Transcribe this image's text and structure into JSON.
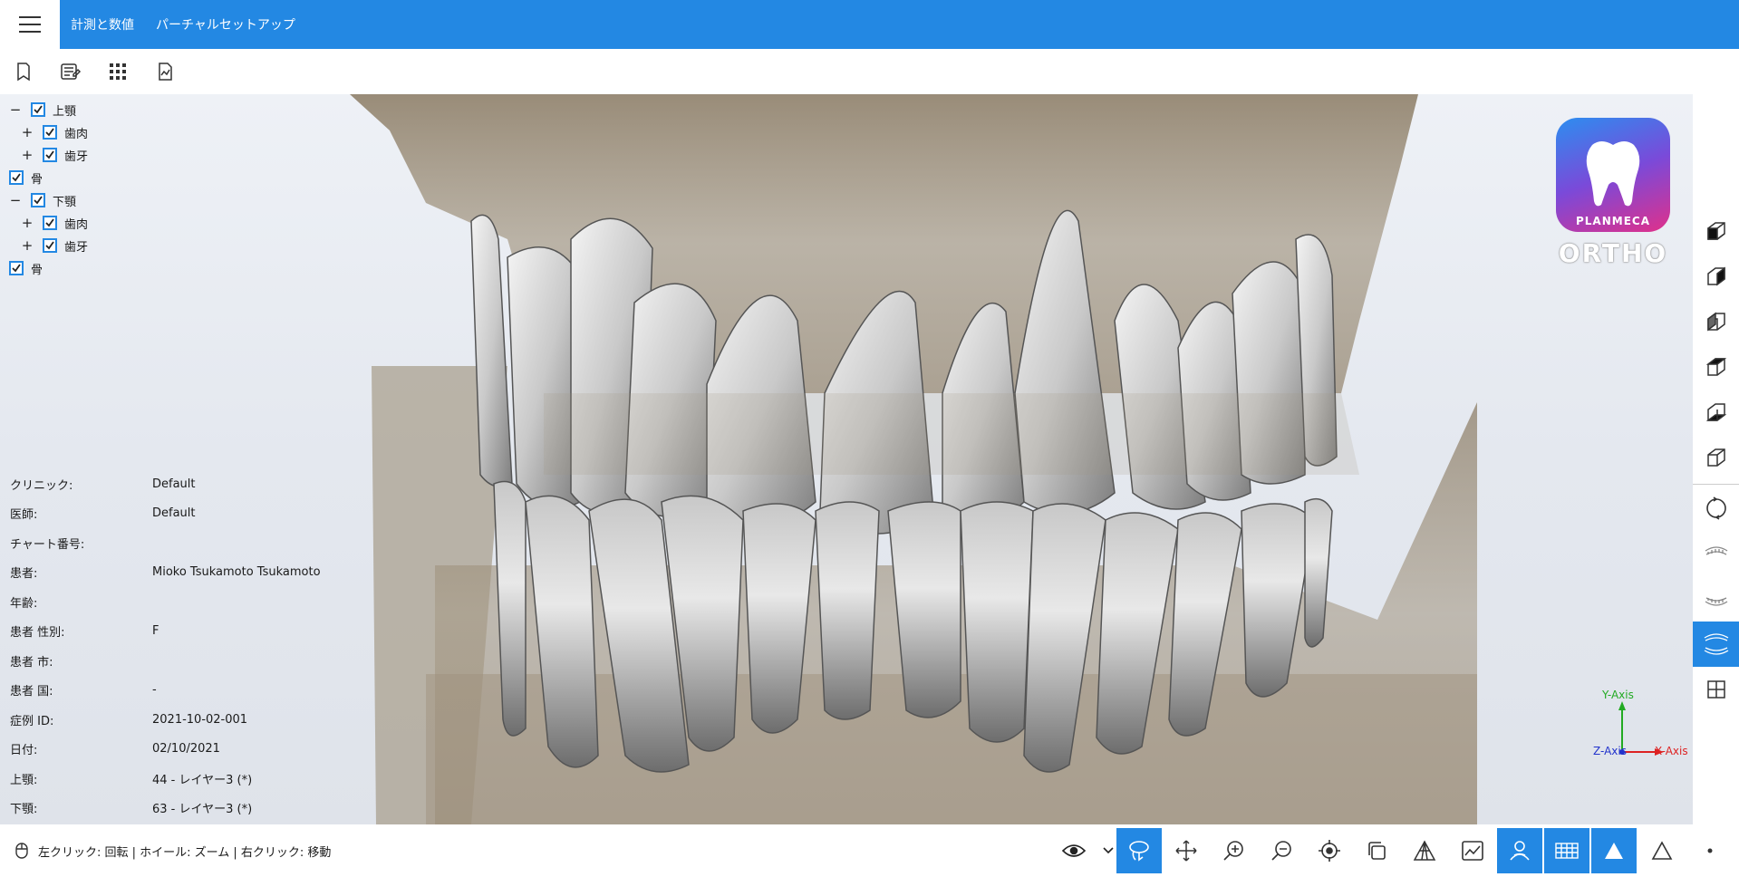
{
  "menu": {
    "items": [
      "計測と数値",
      "パーチャルセットアップ"
    ]
  },
  "tree": [
    {
      "expander": "−",
      "label": "上顎",
      "checked": true,
      "level": 0
    },
    {
      "expander": "+",
      "label": "歯肉",
      "checked": true,
      "level": 1
    },
    {
      "expander": "+",
      "label": "歯牙",
      "checked": true,
      "level": 1
    },
    {
      "expander": "",
      "label": "骨",
      "checked": true,
      "level": 2
    },
    {
      "expander": "−",
      "label": "下顎",
      "checked": true,
      "level": 0
    },
    {
      "expander": "+",
      "label": "歯肉",
      "checked": true,
      "level": 1
    },
    {
      "expander": "+",
      "label": "歯牙",
      "checked": true,
      "level": 1
    },
    {
      "expander": "",
      "label": "骨",
      "checked": true,
      "level": 2
    }
  ],
  "info": [
    {
      "key": "クリニック:",
      "value": "Default"
    },
    {
      "key": "医師:",
      "value": "Default"
    },
    {
      "key": "チャート番号:",
      "value": ""
    },
    {
      "key": "患者:",
      "value": "Mioko Tsukamoto Tsukamoto"
    },
    {
      "key": "年齢:",
      "value": ""
    },
    {
      "key": "患者 性別:",
      "value": "F"
    },
    {
      "key": "患者 市:",
      "value": ""
    },
    {
      "key": "患者 国:",
      "value": "-"
    },
    {
      "key": "症例 ID:",
      "value": "2021-10-02-001"
    },
    {
      "key": "日付:",
      "value": "02/10/2021"
    },
    {
      "key": "上顎:",
      "value": "44 - レイヤー3 (*)"
    },
    {
      "key": "下顎:",
      "value": "63 - レイヤー3 (*)"
    }
  ],
  "logo": {
    "brand": "PLANMECA",
    "product": "ORTHO"
  },
  "axes": {
    "y": "Y-Axis",
    "z": "Z-Axis",
    "x": "X-Axis"
  },
  "status": {
    "hint": "左クリック: 回転 | ホイール: ズーム | 右クリック: 移動"
  },
  "colors": {
    "accent": "#2388e3",
    "y_axis": "#22aa22",
    "x_axis": "#dd2222",
    "z_axis": "#2233cc"
  }
}
